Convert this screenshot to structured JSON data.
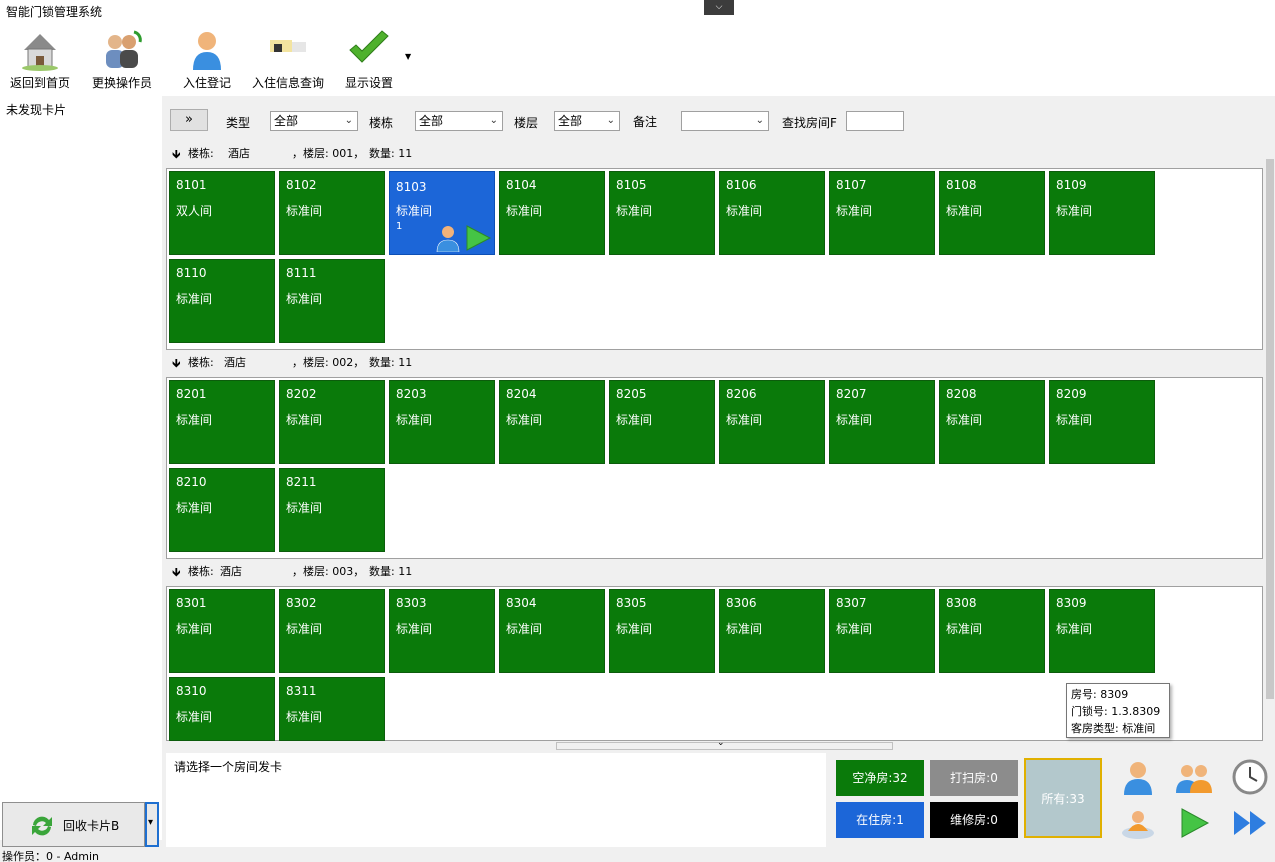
{
  "window": {
    "title": "智能门锁管理系统",
    "collapse_glyph": "⌵"
  },
  "toolbar": {
    "buttons": [
      {
        "label": "返回到首页",
        "icon": "home-icon"
      },
      {
        "label": "更换操作员",
        "icon": "change-operator-icon"
      },
      {
        "label": "入住登记",
        "icon": "checkin-person-icon"
      },
      {
        "label": "入住信息查询",
        "icon": "checkin-query-icon"
      },
      {
        "label": "显示设置",
        "icon": "checkmark-icon"
      }
    ],
    "more_glyph": "▼"
  },
  "left": {
    "status": "未发现卡片",
    "recycle_label": "回收卡片B",
    "recycle_icon": "recycle-icon",
    "dd_glyph": "▾"
  },
  "filter": {
    "expand_glyph": "»",
    "type_label": "类型",
    "type_value": "全部",
    "building_label": "楼栋",
    "building_value": "全部",
    "floor_label": "楼层",
    "floor_value": "全部",
    "remark_label": "备注",
    "remark_value": "",
    "find_label": "查找房间F",
    "find_value": "",
    "arrow_glyph": "⌄"
  },
  "floors": [
    {
      "header": {
        "building_label": "楼栋:",
        "building": "酒店",
        "floor_label": "，楼层: 001，",
        "count_label": "数量: 11"
      },
      "rooms": [
        {
          "no": "8101",
          "type": "双人间"
        },
        {
          "no": "8102",
          "type": "标准间"
        },
        {
          "no": "8103",
          "type": "标准间",
          "extra": "1",
          "selected": true
        },
        {
          "no": "8104",
          "type": "标准间"
        },
        {
          "no": "8105",
          "type": "标准间"
        },
        {
          "no": "8106",
          "type": "标准间"
        },
        {
          "no": "8107",
          "type": "标准间"
        },
        {
          "no": "8108",
          "type": "标准间"
        },
        {
          "no": "8109",
          "type": "标准间"
        },
        {
          "no": "8110",
          "type": "标准间"
        },
        {
          "no": "8111",
          "type": "标准间"
        }
      ]
    },
    {
      "header": {
        "building_label": "楼栋:",
        "building": "酒店",
        "floor_label": "，楼层: 002，",
        "count_label": "数量: 11"
      },
      "rooms": [
        {
          "no": "8201",
          "type": "标准间"
        },
        {
          "no": "8202",
          "type": "标准间"
        },
        {
          "no": "8203",
          "type": "标准间"
        },
        {
          "no": "8204",
          "type": "标准间"
        },
        {
          "no": "8205",
          "type": "标准间"
        },
        {
          "no": "8206",
          "type": "标准间"
        },
        {
          "no": "8207",
          "type": "标准间"
        },
        {
          "no": "8208",
          "type": "标准间"
        },
        {
          "no": "8209",
          "type": "标准间"
        },
        {
          "no": "8210",
          "type": "标准间"
        },
        {
          "no": "8211",
          "type": "标准间"
        }
      ]
    },
    {
      "header": {
        "building_label": "楼栋:",
        "building": "酒店",
        "floor_label": "，楼层: 003，",
        "count_label": "数量: 11"
      },
      "rooms": [
        {
          "no": "8301",
          "type": "标准间"
        },
        {
          "no": "8302",
          "type": "标准间"
        },
        {
          "no": "8303",
          "type": "标准间"
        },
        {
          "no": "8304",
          "type": "标准间"
        },
        {
          "no": "8305",
          "type": "标准间"
        },
        {
          "no": "8306",
          "type": "标准间"
        },
        {
          "no": "8307",
          "type": "标准间"
        },
        {
          "no": "8308",
          "type": "标准间"
        },
        {
          "no": "8309",
          "type": "标准间"
        },
        {
          "no": "8310",
          "type": "标准间"
        },
        {
          "no": "8311",
          "type": "标准间"
        }
      ]
    }
  ],
  "tooltip": {
    "line1": "房号: 8309",
    "line2": "门锁号: 1.3.8309",
    "line3": "客房类型: 标准间"
  },
  "message": "请选择一个房间发卡",
  "stats": {
    "vacant": "空净房:32",
    "cleaning": "打扫房:0",
    "all": "所有:33",
    "occupied": "在住房:1",
    "repair": "维修房:0"
  },
  "colors": {
    "vacant": "#0a7a0a",
    "occupied": "#1c66d8",
    "cleaning": "#8c8c8c",
    "repair": "#000000",
    "all": "#b3c8cc"
  },
  "statusbar": {
    "text": "操作员：0 - Admin"
  }
}
